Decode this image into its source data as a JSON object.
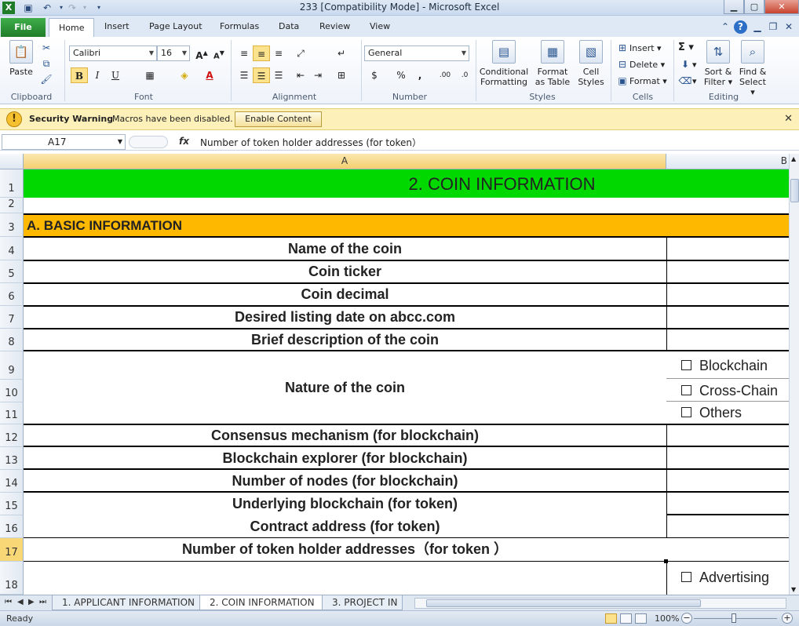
{
  "window": {
    "title": "233  [Compatibility Mode]  -  Microsoft Excel",
    "app_icon": "excel-icon"
  },
  "ribbon_tabs": {
    "file": "File",
    "tabs": [
      "Home",
      "Insert",
      "Page Layout",
      "Formulas",
      "Data",
      "Review",
      "View"
    ],
    "active": "Home"
  },
  "ribbon": {
    "clipboard": {
      "paste": "Paste",
      "label": "Clipboard"
    },
    "font": {
      "name": "Calibri",
      "size": "16",
      "label": "Font",
      "bold": "B",
      "italic": "I",
      "underline": "U"
    },
    "alignment": {
      "label": "Alignment"
    },
    "number": {
      "format": "General",
      "label": "Number",
      "currency": "$",
      "percent": "%",
      "comma": ",",
      "inc_dec": ".00",
      "dec_dec": ".0"
    },
    "styles": {
      "conditional": "Conditional",
      "formatting": "Formatting",
      "format": "Format",
      "as_table": "as Table",
      "cell": "Cell",
      "cell_styles": "Styles",
      "label": "Styles"
    },
    "cells": {
      "insert": "Insert",
      "delete": "Delete",
      "format": "Format",
      "label": "Cells"
    },
    "editing": {
      "sum": "Σ",
      "sort": "Sort &",
      "filter": "Filter",
      "find": "Find &",
      "select": "Select",
      "label": "Editing"
    }
  },
  "security_bar": {
    "title": "Security Warning",
    "message": "Macros have been disabled.",
    "button": "Enable Content"
  },
  "formula_bar": {
    "name_box": "A17",
    "fx": "fx",
    "content": "Number of token holder addresses (for token）"
  },
  "columns": [
    "A",
    "B"
  ],
  "rows": [
    {
      "num": "1",
      "text": "2. COIN INFORMATION"
    },
    {
      "num": "2",
      "text": ""
    },
    {
      "num": "3",
      "text": "A. BASIC INFORMATION"
    },
    {
      "num": "4",
      "text": "Name of the coin"
    },
    {
      "num": "5",
      "text": "Coin ticker"
    },
    {
      "num": "6",
      "text": "Coin decimal"
    },
    {
      "num": "7",
      "text": "Desired listing date on abcc.com"
    },
    {
      "num": "8",
      "text": "Brief description of the coin"
    },
    {
      "num": "9",
      "text": ""
    },
    {
      "num": "10",
      "text": "Nature of the coin"
    },
    {
      "num": "11",
      "text": ""
    },
    {
      "num": "12",
      "text": "Consensus mechanism (for blockchain)"
    },
    {
      "num": "13",
      "text": "Blockchain explorer (for blockchain)"
    },
    {
      "num": "14",
      "text": "Number of nodes (for blockchain)"
    },
    {
      "num": "15",
      "text": "Underlying blockchain (for token)"
    },
    {
      "num": "16",
      "text": "Contract address (for token)"
    },
    {
      "num": "17",
      "text": "Number of token holder addresses（for token ）"
    },
    {
      "num": "18",
      "text": ""
    }
  ],
  "checkboxes": [
    "Blockchain",
    "Cross-Chain",
    "Others",
    "Advertising"
  ],
  "colors": {
    "row1_fill": "#00D800",
    "row3_fill": "#FFB800",
    "selected_header": "#F8D776"
  },
  "sheet_tabs": {
    "tabs": [
      "1. APPLICANT INFORMATION",
      "2. COIN INFORMATION",
      "3. PROJECT IN"
    ],
    "active": "2. COIN INFORMATION"
  },
  "status_bar": {
    "ready": "Ready",
    "zoom": "100%"
  }
}
